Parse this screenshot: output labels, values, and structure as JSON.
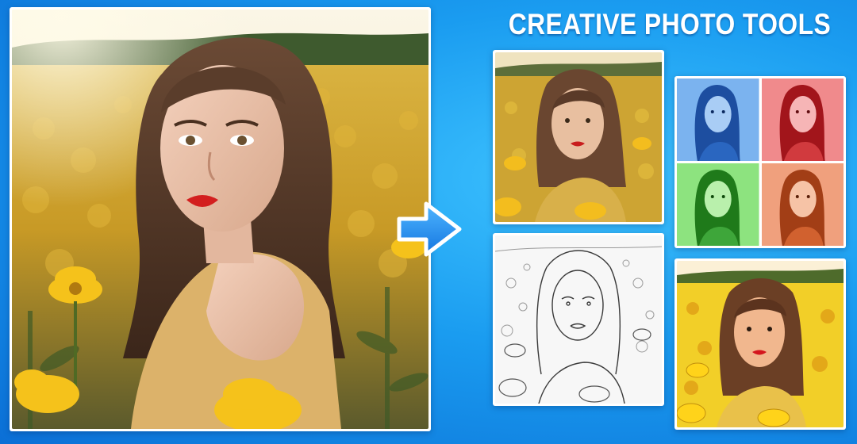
{
  "title": "CREATIVE PHOTO TOOLS",
  "colors": {
    "background": "#1a9cf0",
    "arrow": "#1e90ff",
    "title_text": "#ffffff",
    "frame": "#ffffff"
  },
  "images": {
    "main": "original-photo",
    "effects": [
      "oil-painting-effect",
      "pop-art-effect",
      "pencil-sketch-effect",
      "cartoon-effect"
    ]
  },
  "pop_art_tints": [
    "#3a7fd9",
    "#e0393e",
    "#4cc43c",
    "#e0663a"
  ]
}
